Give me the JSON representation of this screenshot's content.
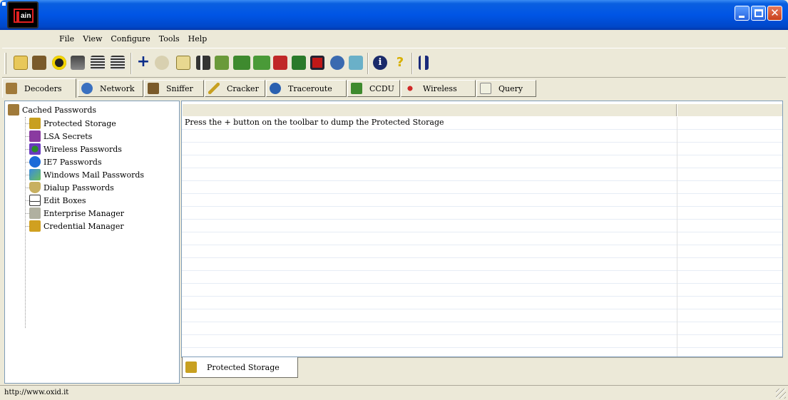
{
  "window": {
    "title": "",
    "logo_text": "ain"
  },
  "menu": [
    "File",
    "View",
    "Configure",
    "Tools",
    "Help"
  ],
  "toolbar": {
    "icons": [
      "open-icon",
      "sniffer-start-icon",
      "hazard-icon",
      "arp-icon",
      "reset-icon",
      "reset-all-icon",
      "add-icon",
      "remove-icon",
      "export-icon",
      "route-icon",
      "certificate-icon",
      "grid-icon",
      "grid2-icon",
      "table-icon",
      "monitor-icon",
      "window-icon",
      "network-icon",
      "settings-icon",
      "info-icon",
      "help-icon",
      "tool-icon"
    ]
  },
  "tabs": [
    {
      "label": "Decoders",
      "icon": "decoders-icon"
    },
    {
      "label": "Network",
      "icon": "network-icon"
    },
    {
      "label": "Sniffer",
      "icon": "sniffer-icon"
    },
    {
      "label": "Cracker",
      "icon": "cracker-icon"
    },
    {
      "label": "Traceroute",
      "icon": "traceroute-icon"
    },
    {
      "label": "CCDU",
      "icon": "ccdu-icon"
    },
    {
      "label": "Wireless",
      "icon": "wireless-icon"
    },
    {
      "label": "Query",
      "icon": "query-icon"
    }
  ],
  "tree": {
    "root": "Cached Passwords",
    "items": [
      "Protected Storage",
      "LSA Secrets",
      "Wireless Passwords",
      "IE7 Passwords",
      "Windows Mail Passwords",
      "Dialup Passwords",
      "Edit Boxes",
      "Enterprise Manager",
      "Credential Manager"
    ]
  },
  "list": {
    "message": "Press the + button on the toolbar to dump the Protected Storage"
  },
  "bottom_tab": {
    "label": "Protected Storage"
  },
  "status": {
    "text": "http://www.oxid.it"
  },
  "colors": {
    "titlebar": "#0055e5",
    "face": "#ece9d8",
    "close": "#c8401b"
  }
}
